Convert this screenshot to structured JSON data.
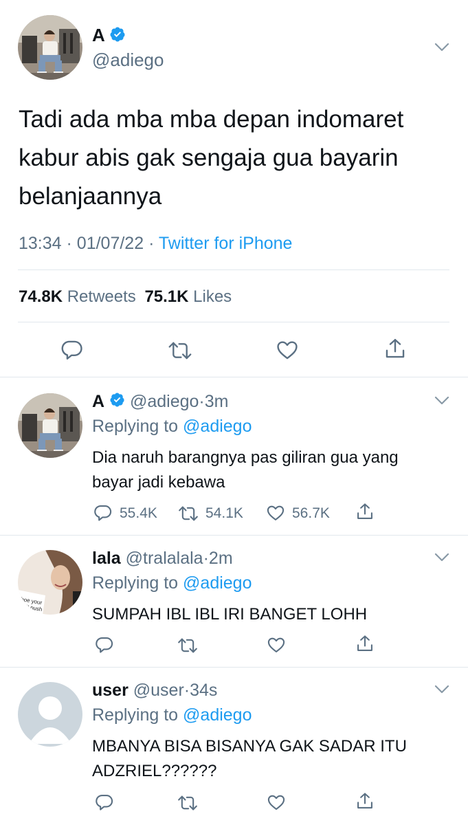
{
  "main_tweet": {
    "display_name": "A",
    "handle": "@adiego",
    "text_lines": [
      "Tadi ada mba mba depan indomaret",
      "kabur abis gak sengaja gua bayarin",
      "belanjaannya"
    ],
    "time": "13:34",
    "date": "01/07/22",
    "source": "Twitter for iPhone",
    "retweets_count": "74.8K",
    "retweets_label": "Retweets",
    "likes_count": "75.1K",
    "likes_label": "Likes"
  },
  "replies": [
    {
      "display_name": "A",
      "handle": "@adiego",
      "time": "3m",
      "replying_label": "Replying to",
      "replying_handle": "@adiego",
      "text_lines": [
        "Dia naruh barangnya pas giliran gua yang",
        "bayar jadi kebawa"
      ],
      "reply_count": "55.4K",
      "retweet_count": "54.1K",
      "like_count": "56.7K"
    },
    {
      "display_name": "lala",
      "handle": "@tralalala",
      "time": "2m",
      "replying_label": "Replying to",
      "replying_handle": "@adiego",
      "text_lines": [
        "SUMPAH IBL IBL IRI BANGET LOHH"
      ],
      "avatar_caption_1": "hoe your",
      "avatar_caption_2": "'n't push"
    },
    {
      "display_name": "user",
      "handle": "@user",
      "time": "34s",
      "replying_label": "Replying to",
      "replying_handle": "@adiego",
      "text_lines": [
        "MBANYA BISA BISANYA GAK SADAR ITU",
        "ADZRIEL??????"
      ]
    }
  ],
  "separator": "·",
  "icons": [
    "chevron-down-icon",
    "verified-badge-icon",
    "reply-icon",
    "retweet-icon",
    "like-icon",
    "share-icon"
  ],
  "colors": {
    "accent": "#1d9bf0",
    "secondary_text": "#5b7083",
    "divider": "#e1e8ed"
  }
}
